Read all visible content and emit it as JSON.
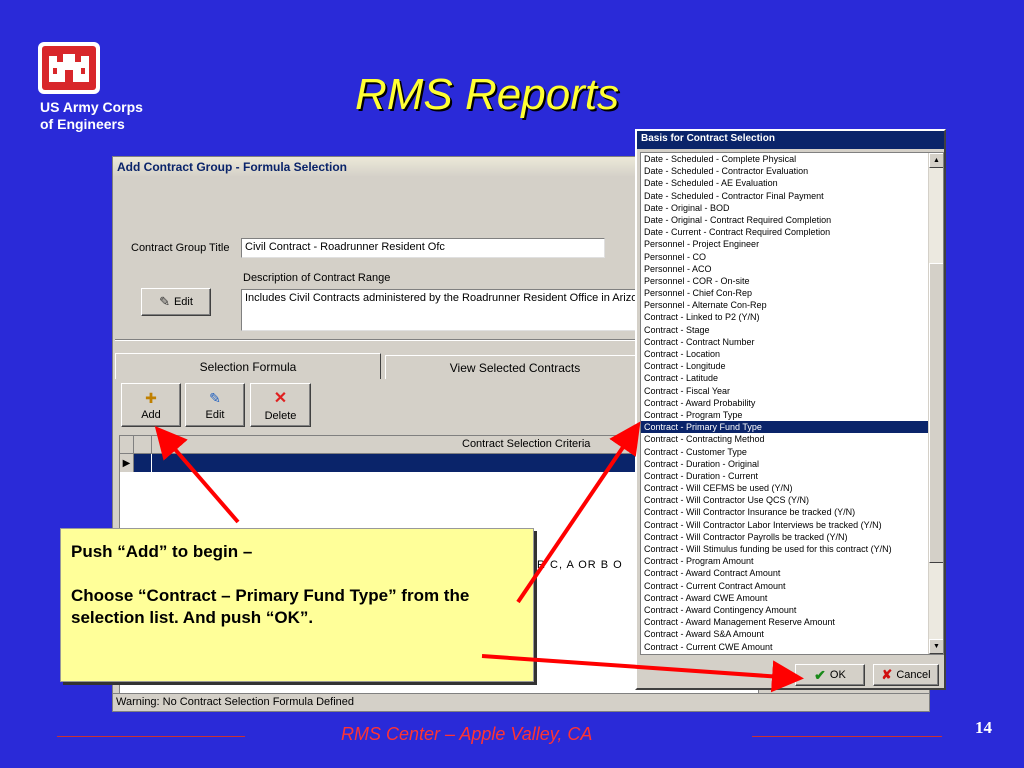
{
  "slide": {
    "title": "RMS Reports",
    "org_line1": "US Army Corps",
    "org_line2": "of Engineers",
    "footer": "RMS Center – Apple Valley, CA",
    "page_number": "14"
  },
  "main_dialog": {
    "title": "Add Contract Group - Formula Selection",
    "group_title_label": "Contract Group Title",
    "group_title_value": "Civil Contract - Roadrunner Resident Ofc",
    "description_label": "Description of Contract Range",
    "description_value": "Includes Civil Contracts administered by the Roadrunner Resident Office in Arizona",
    "edit_label": "Edit",
    "tabs": [
      {
        "label": "Selection Formula"
      },
      {
        "label": "View Selected Contracts"
      }
    ],
    "toolbar": {
      "add_label": "Add",
      "edit_label": "Edit",
      "delete_label": "Delete"
    },
    "grid_header": "Contract Selection Criteria",
    "formula_fragment": "R C,   A OR B O",
    "status": "Warning:  No Contract Selection Formula Defined"
  },
  "list_dialog": {
    "title": "Basis for Contract Selection",
    "items": [
      "Date - Scheduled - Complete Physical",
      "Date - Scheduled - Contractor Evaluation",
      "Date - Scheduled - AE Evaluation",
      "Date - Scheduled - Contractor Final Payment",
      "Date - Original - BOD",
      "Date - Original - Contract Required Completion",
      "Date - Current - Contract Required Completion",
      "Personnel - Project Engineer",
      "Personnel - CO",
      "Personnel - ACO",
      "Personnel - COR - On-site",
      "Personnel - Chief Con-Rep",
      "Personnel - Alternate Con-Rep",
      "Contract - Linked to P2 (Y/N)",
      "Contract - Stage",
      "Contract - Contract Number",
      "Contract - Location",
      "Contract - Longitude",
      "Contract - Latitude",
      "Contract - Fiscal Year",
      "Contract - Award Probability",
      "Contract - Program Type",
      "Contract - Primary Fund Type",
      "Contract - Contracting Method",
      "Contract - Customer Type",
      "Contract - Duration - Original",
      "Contract - Duration - Current",
      "Contract - Will CEFMS be used (Y/N)",
      "Contract - Will Contractor Use QCS (Y/N)",
      "Contract - Will Contractor Insurance be tracked (Y/N)",
      "Contract - Will Contractor Labor Interviews be tracked (Y/N)",
      "Contract - Will Contractor Payrolls be tracked (Y/N)",
      "Contract - Will Stimulus funding be used for this contract (Y/N)",
      "Contract - Program Amount",
      "Contract - Award Contract Amount",
      "Contract - Current Contract Amount",
      "Contract - Award CWE Amount",
      "Contract - Award Contingency Amount",
      "Contract - Award Management Reserve Amount",
      "Contract - Award S&A Amount",
      "Contract - Current CWE Amount"
    ],
    "selected_index": 22,
    "ok_label": "OK",
    "cancel_label": "Cancel"
  },
  "callout": {
    "line1": "Push “Add” to begin –",
    "line2": "Choose “Contract – Primary Fund Type” from the selection list. And push “OK”."
  },
  "colors": {
    "background": "#2a2ad8",
    "title": "#ffff33",
    "callout_bg": "#ffff99",
    "arrow": "#ff0000",
    "selection": "#0a246a"
  }
}
